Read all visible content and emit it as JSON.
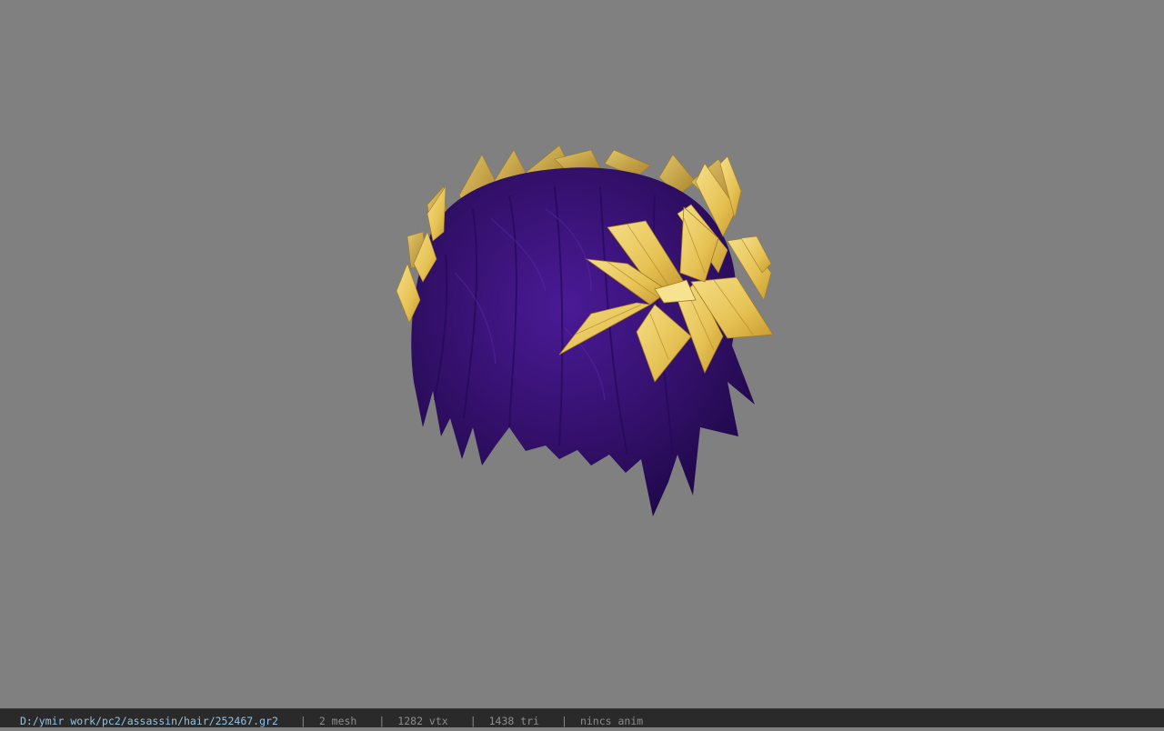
{
  "status_bar": {
    "file_path": "D:/ymir work/pc2/assassin/hair/252467.gr2",
    "separator": "|",
    "mesh_count": "2 mesh",
    "vertex_count": "1282 vtx",
    "triangle_count": "1438 tri",
    "animation": "nincs anim"
  },
  "colors": {
    "viewport_background": "#808080",
    "hair_purple": "#34106e",
    "leaf_gold": "#e8c65a",
    "status_path": "#8fc3e6",
    "status_text": "#8c8c8c"
  },
  "model": {
    "description_icon": "hair-with-laurel-wreath-model"
  }
}
